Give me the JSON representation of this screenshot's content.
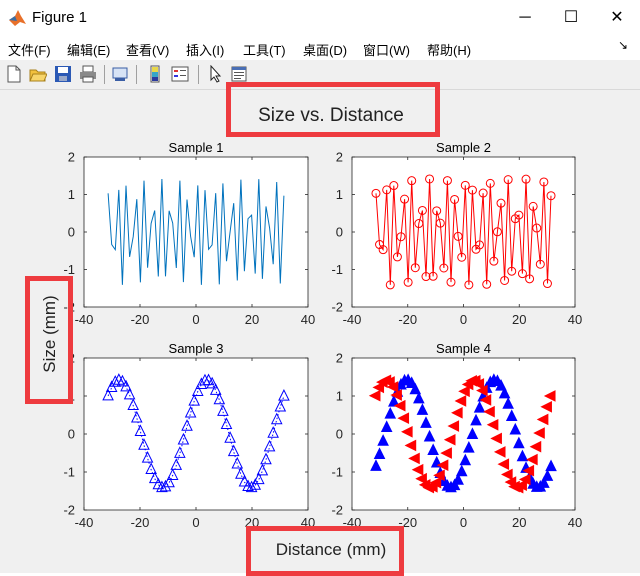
{
  "window": {
    "title": "Figure 1",
    "minimize": "─",
    "maximize": "☐",
    "close": "✕"
  },
  "menu": {
    "items": [
      "文件(F)",
      "编辑(E)",
      "查看(V)",
      "插入(I)",
      "工具(T)",
      "桌面(D)",
      "窗口(W)",
      "帮助(H)"
    ],
    "dock_arrow": "↘"
  },
  "toolbar": {
    "icons": [
      "new-figure-icon",
      "open-file-icon",
      "save-icon",
      "print-icon",
      "link-plot-icon",
      "colorbar-icon",
      "legend-icon",
      "pointer-icon",
      "property-editor-icon"
    ]
  },
  "figure": {
    "title": "Size vs. Distance",
    "xlabel": "Distance (mm)",
    "ylabel": "Size (mm)",
    "highlight_color": "#ee3b3f"
  },
  "chart_data": [
    {
      "type": "line",
      "title": "Sample 1",
      "xlim": [
        -40,
        40
      ],
      "ylim": [
        -2,
        2
      ],
      "xticks": [
        -40,
        -20,
        0,
        20,
        40
      ],
      "yticks": [
        -2,
        -1,
        0,
        1,
        2
      ],
      "series": [
        {
          "function": "sin(2x)+cos(2x)",
          "x_range": [
            -31.4,
            31.4
          ],
          "points": 50,
          "color": "#0072bd",
          "marker": "none",
          "line": "solid"
        }
      ]
    },
    {
      "type": "line",
      "title": "Sample 2",
      "xlim": [
        -40,
        40
      ],
      "ylim": [
        -2,
        2
      ],
      "xticks": [
        -40,
        -20,
        0,
        20,
        40
      ],
      "yticks": [
        -2,
        -1,
        0,
        1,
        2
      ],
      "series": [
        {
          "function": "sin(2x)+cos(2x)",
          "x_range": [
            -31.4,
            31.4
          ],
          "points": 50,
          "color": "#ff0000",
          "marker": "circle",
          "line": "solid"
        }
      ]
    },
    {
      "type": "scatter",
      "title": "Sample 3",
      "xlim": [
        -40,
        40
      ],
      "ylim": [
        -2,
        2
      ],
      "xticks": [
        -40,
        -20,
        0,
        20,
        40
      ],
      "yticks": [
        -2,
        -1,
        0,
        1,
        2
      ],
      "series": [
        {
          "function": "sin(x/5)+cos(x/5)",
          "x_range": [
            -31.4,
            31.4
          ],
          "points": 50,
          "color": "#0000ff",
          "marker": "triangle-up-open",
          "line": "dotted"
        }
      ]
    },
    {
      "type": "scatter",
      "title": "Sample 4",
      "xlim": [
        -40,
        40
      ],
      "ylim": [
        -2,
        2
      ],
      "xticks": [
        -40,
        -20,
        0,
        20,
        40
      ],
      "yticks": [
        -2,
        -1,
        0,
        1,
        2
      ],
      "series": [
        {
          "function": "sin(x/5)-cos(x/5)+? approx",
          "formula": "sqrt2*sin(x/5-0.65)",
          "x_range": [
            -31.4,
            31.4
          ],
          "points": 50,
          "color": "#0000ff",
          "marker": "triangle-up-filled"
        },
        {
          "formula": "sqrt2*sin(x/5+0.79)",
          "x_range": [
            -31.4,
            31.4
          ],
          "points": 50,
          "color": "#ff0000",
          "marker": "triangle-left-filled"
        }
      ]
    }
  ]
}
